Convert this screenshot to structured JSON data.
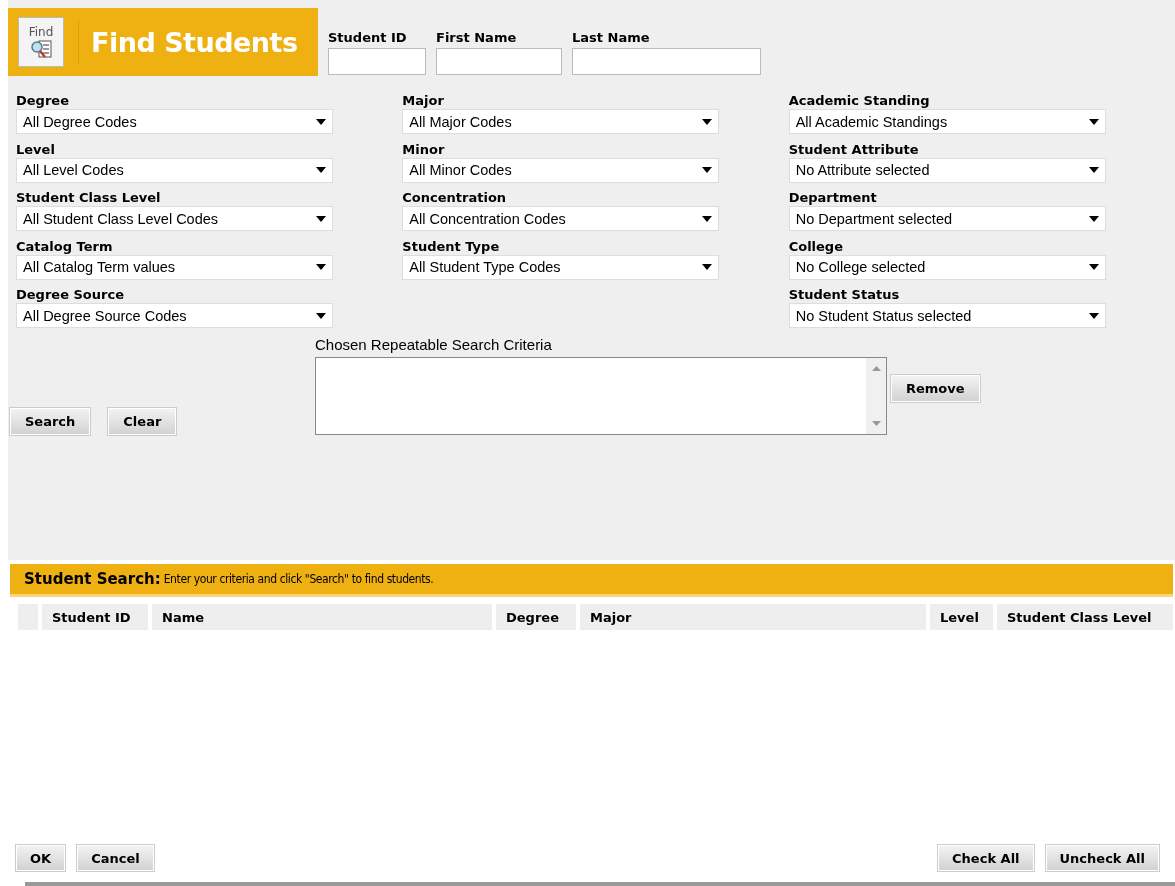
{
  "header": {
    "icon_label": "Find",
    "title": "Find Students"
  },
  "name_fields": [
    {
      "label": "Student ID"
    },
    {
      "label": "First Name"
    },
    {
      "label": "Last Name"
    }
  ],
  "filter_columns": [
    [
      {
        "label": "Degree",
        "value": "All Degree Codes"
      },
      {
        "label": "Level",
        "value": "All Level Codes"
      },
      {
        "label": "Student Class Level",
        "value": "All Student Class Level Codes"
      },
      {
        "label": "Catalog Term",
        "value": "All Catalog Term values"
      },
      {
        "label": "Degree Source",
        "value": "All Degree Source Codes"
      }
    ],
    [
      {
        "label": "Major",
        "value": "All Major Codes"
      },
      {
        "label": "Minor",
        "value": "All Minor Codes"
      },
      {
        "label": "Concentration",
        "value": "All Concentration Codes"
      },
      {
        "label": "Student Type",
        "value": "All Student Type Codes"
      }
    ],
    [
      {
        "label": "Academic Standing",
        "value": "All Academic Standings"
      },
      {
        "label": "Student Attribute",
        "value": "No Attribute selected"
      },
      {
        "label": "Department",
        "value": "No Department selected"
      },
      {
        "label": "College",
        "value": "No College selected"
      },
      {
        "label": "Student Status",
        "value": "No Student Status selected"
      }
    ]
  ],
  "criteria": {
    "label": "Chosen Repeatable Search Criteria",
    "remove_button": "Remove"
  },
  "search_buttons": [
    "Search",
    "Clear"
  ],
  "results": {
    "title": "Student Search:",
    "hint": "Enter your criteria and click \"Search\" to find students.",
    "columns": [
      "Student ID",
      "Name",
      "Degree",
      "Major",
      "Level",
      "Student Class Level"
    ]
  },
  "footer_left": [
    "OK",
    "Cancel"
  ],
  "footer_right": [
    "Check All",
    "Uncheck All"
  ]
}
